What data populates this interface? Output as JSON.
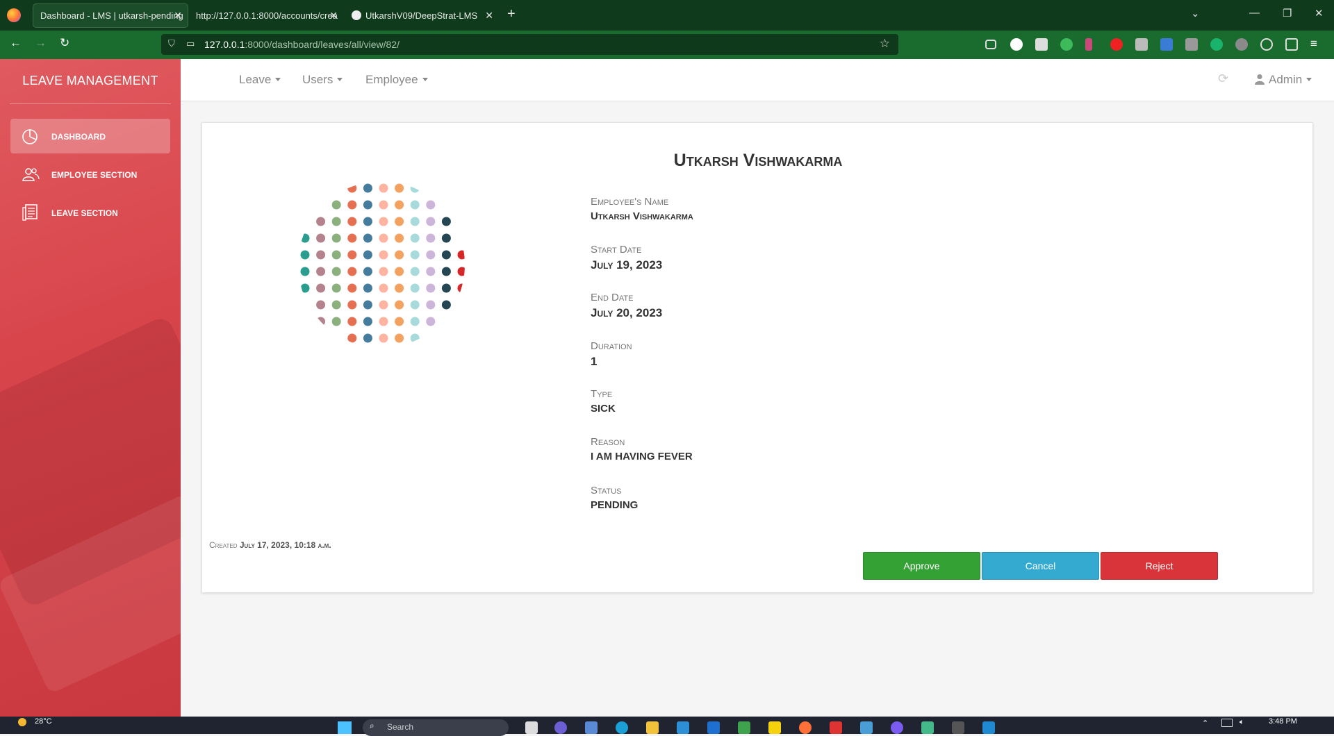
{
  "browser": {
    "tabs": [
      {
        "title": "Dashboard - LMS | utkarsh-pending"
      },
      {
        "title": "http://127.0.0.1:8000/accounts/crea"
      },
      {
        "title": "UtkarshV09/DeepStrat-LMS"
      }
    ],
    "url_host": "127.0.0.1",
    "url_path": ":8000/dashboard/leaves/all/view/82/"
  },
  "sidebar": {
    "brand": "LEAVE MANAGEMENT",
    "items": [
      {
        "label": "DASHBOARD"
      },
      {
        "label": "EMPLOYEE SECTION"
      },
      {
        "label": "LEAVE SECTION"
      }
    ]
  },
  "topbar": {
    "menus": [
      "Leave",
      "Users",
      "Employee"
    ],
    "user": "Admin"
  },
  "leave": {
    "title": "Utkarsh Vishwakarma",
    "fields": [
      {
        "label": "Employee's Name",
        "value": "Utkarsh Vishwakarma"
      },
      {
        "label": "Start Date",
        "value": "July 19, 2023"
      },
      {
        "label": "End Date",
        "value": "July 20, 2023"
      },
      {
        "label": "Duration",
        "value": "1"
      },
      {
        "label": "Type",
        "value": "SICK"
      },
      {
        "label": "Reason",
        "value": "I AM HAVING FEVER"
      },
      {
        "label": "Status",
        "value": "PENDING"
      }
    ],
    "created_label": "Created",
    "created_value": "July 17, 2023, 10:18 a.m."
  },
  "actions": {
    "approve": "Approve",
    "cancel": "Cancel",
    "reject": "Reject"
  },
  "taskbar": {
    "weather": "28°C",
    "search": "Search",
    "time": "3:48 PM"
  },
  "colors": {
    "sidebar": "#d8464c",
    "approve": "#34a134",
    "cancel": "#35aad0",
    "reject": "#d9343a",
    "browser_chrome": "#1a6b2e"
  },
  "avatar_palette": [
    "#2a9d8f",
    "#e76f51",
    "#f4a261",
    "#264653",
    "#e9c46a",
    "#9d8189",
    "#6d597a",
    "#b5838d",
    "#457b9d",
    "#a8dadc",
    "#d62828",
    "#f77f00",
    "#fcbf49",
    "#003049",
    "#8ab17d",
    "#ffb4a2",
    "#cdb4db",
    "#222222",
    "#b7b7a4",
    "#e63946"
  ]
}
